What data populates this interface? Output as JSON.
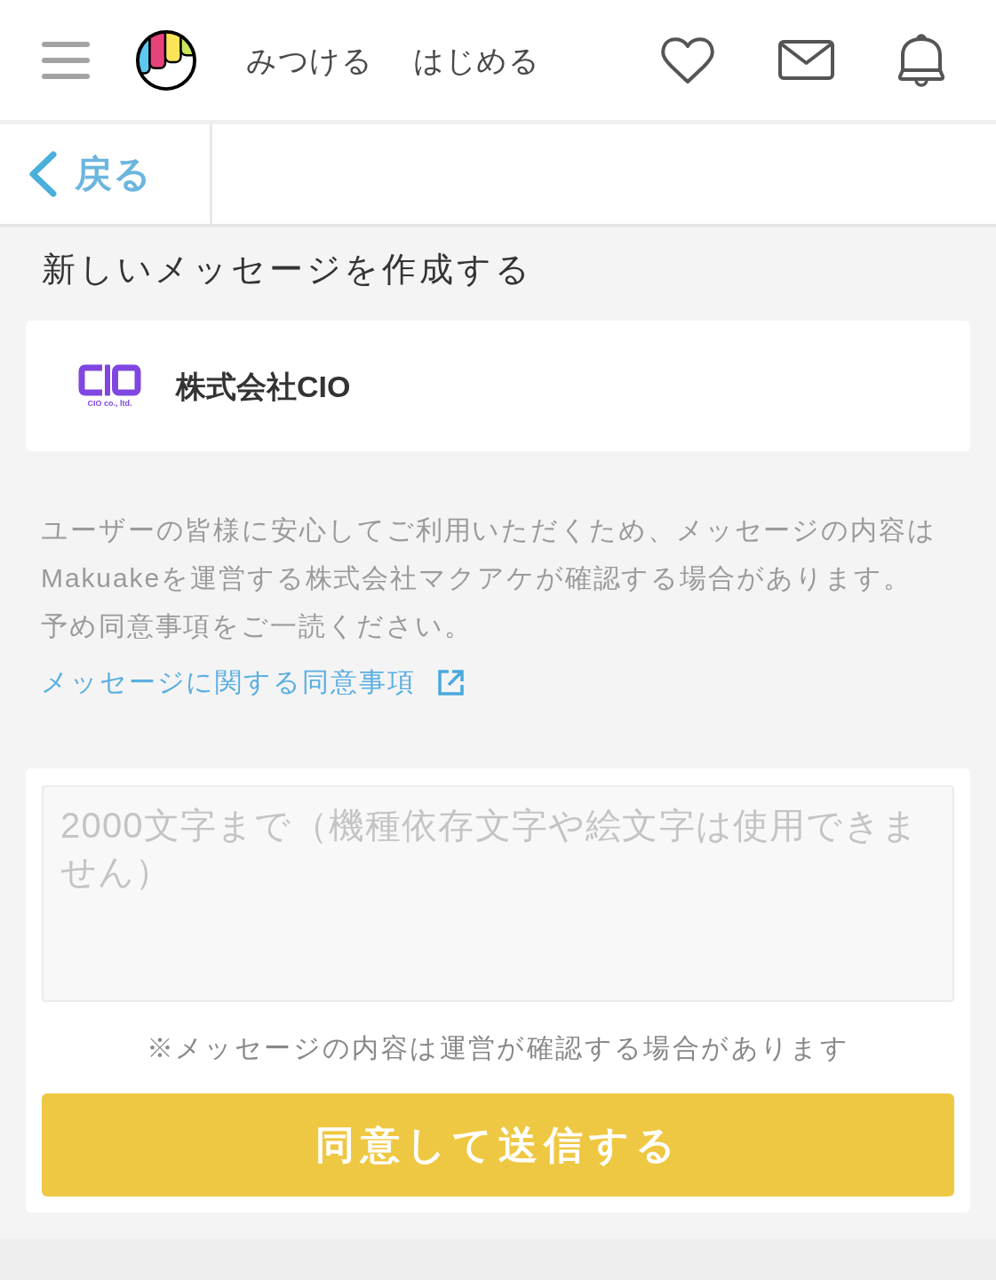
{
  "header": {
    "nav": [
      {
        "label": "みつける"
      },
      {
        "label": "はじめる"
      }
    ]
  },
  "back": {
    "label": "戻る"
  },
  "page_title": "新しいメッセージを作成する",
  "recipient": {
    "name": "株式会社CIO",
    "logo_caption": "CIO co., ltd."
  },
  "notice": {
    "lines": [
      "ユーザーの皆様に安心してご利用いただくため、メッセージの内容はMakuakeを運営する株式会社マクアケが確認する場合があります。",
      "予め同意事項をご一読ください。"
    ],
    "link": "メッセージに関する同意事項"
  },
  "form": {
    "message": {
      "placeholder": "2000文字まで（機種依存文字や絵文字は使用できません）"
    },
    "note": "※メッセージの内容は運営が確認する場合があります",
    "submit": "同意して送信する"
  }
}
